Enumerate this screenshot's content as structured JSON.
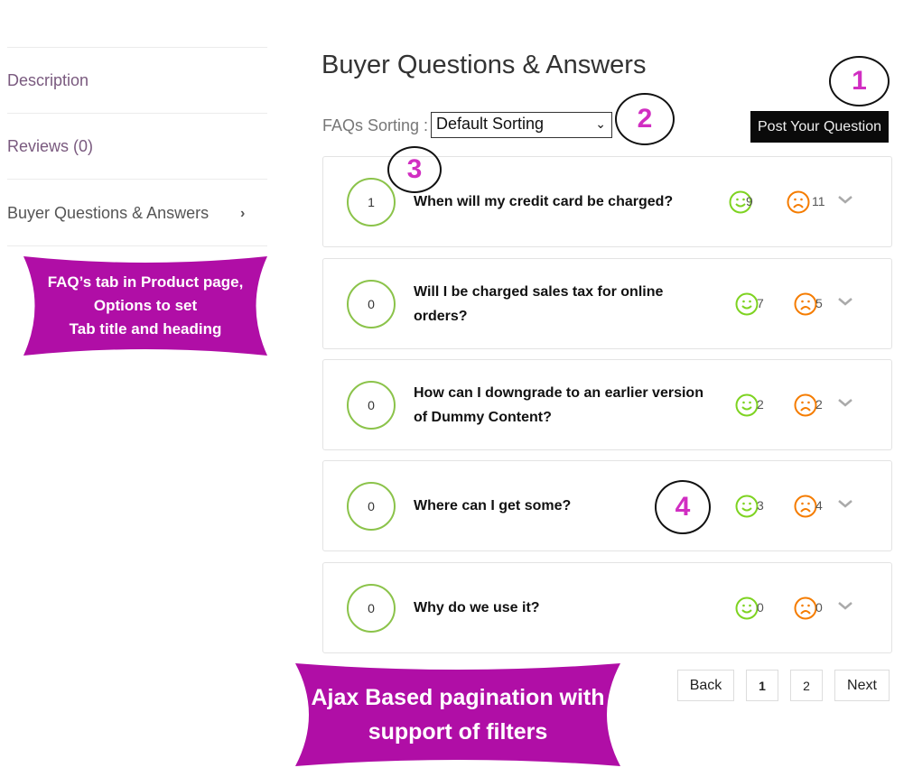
{
  "tabs": [
    {
      "label": "Description"
    },
    {
      "label": "Reviews (0)"
    },
    {
      "label": "Buyer Questions & Answers"
    }
  ],
  "heading": "Buyer Questions & Answers",
  "sorting": {
    "label": "FAQs Sorting :",
    "selected": "Default Sorting"
  },
  "post_button": "Post Your Question",
  "faqs": [
    {
      "count": "1",
      "question": "When will my credit card be charged?",
      "likes": "9",
      "dislikes": "11"
    },
    {
      "count": "0",
      "question": "Will I be charged sales tax for online orders?",
      "likes": "7",
      "dislikes": "5"
    },
    {
      "count": "0",
      "question": "How can I downgrade to an earlier version of Dummy Content?",
      "likes": "2",
      "dislikes": "2"
    },
    {
      "count": "0",
      "question": "Where can I get some?",
      "likes": "3",
      "dislikes": "4"
    },
    {
      "count": "0",
      "question": "Why do we use it?",
      "likes": "0",
      "dislikes": "0"
    }
  ],
  "pagination": {
    "back": "Back",
    "pages": [
      "1",
      "2"
    ],
    "next": "Next"
  },
  "annotations": {
    "a1": "1",
    "a2": "2",
    "a3": "3",
    "a4": "4",
    "left_banner": [
      "FAQ’s tab in Product page,",
      "Options to set",
      "Tab title and heading"
    ],
    "bottom_banner": [
      "Ajax Based pagination with",
      "support of filters"
    ]
  },
  "colors": {
    "like": "#7ed321",
    "dislike": "#f57c00",
    "counter_ring": "#8bc34a",
    "annotation": "#b00ea6"
  }
}
